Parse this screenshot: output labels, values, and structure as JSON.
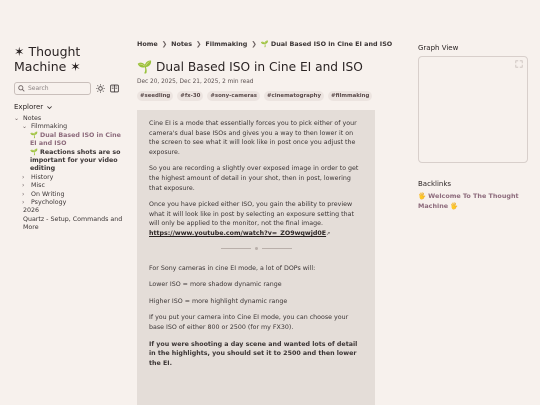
{
  "site": {
    "title": "✶ Thought Machine ✶"
  },
  "search": {
    "placeholder": "Search"
  },
  "explorer": {
    "label": "Explorer",
    "tree": {
      "notes": "Notes",
      "filmmaking": "Filmmaking",
      "item_dual_iso": "🌱 Dual Based ISO in Cine EI and ISO",
      "item_reaction": "🌱 Reactions shots are so important for your video editing",
      "history": "History",
      "misc": "Misc",
      "on_writing": "On Writing",
      "psychology": "Psychology",
      "year": "2026",
      "quartz": "Quartz - Setup, Commands and More"
    }
  },
  "breadcrumb": {
    "home": "Home",
    "notes": "Notes",
    "filmmaking": "Filmmaking",
    "current": "🌱 Dual Based ISO in Cine EI and ISO",
    "sep": "❯"
  },
  "article": {
    "title": "🌱 Dual Based ISO in Cine EI and ISO",
    "meta": "Dec 20, 2025,  Dec 21, 2025,  2 min read",
    "tags": [
      "#seedling",
      "#fx-30",
      "#sony-cameras",
      "#cinematography",
      "#filmmaking"
    ],
    "p1": "Cine EI is a mode that essentially forces you to pick either of your camera's dual base ISOs and gives you a way to then lower it on the screen to see what it will look like in post once you adjust the exposure.",
    "p2": "So you are recording a slightly over exposed image in order to get the highest amount of detail in your shot, then in post, lowering that exposure.",
    "p3": "Once you have picked either ISO, you gain the ability to preview what it will look like in post by selecting an exposure setting that will only be applied to the monitor, not the final image.",
    "p3_link": "https://www.youtube.com/watch?v=_ZO9wqwjd0E",
    "p4": "For Sony cameras in cine EI mode, a lot of DOPs will:",
    "p5": "Lower ISO = more shadow dynamic range",
    "p6": "Higher ISO = more highlight dynamic range",
    "p7": "If you put your camera into Cine EI mode, you can choose your base ISO of either 800 or 2500 (for my FX30).",
    "p8": "If you were shooting a day scene and wanted lots of detail in the highlights, you should set it to 2500 and then lower the EI."
  },
  "graph": {
    "label": "Graph View"
  },
  "backlinks": {
    "label": "Backlinks",
    "item": "🖐 Welcome To The Thought Machine 🖐"
  }
}
